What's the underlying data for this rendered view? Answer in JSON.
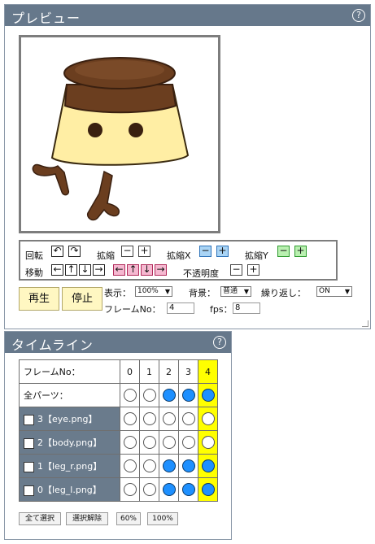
{
  "preview": {
    "title": "プレビュー",
    "help": "?",
    "tools": {
      "rotate_label": "回転",
      "rotate_ccw": "↶",
      "rotate_cw": "↷",
      "scale_label": "拡縮",
      "scale_x_label": "拡縮X",
      "scale_y_label": "拡縮Y",
      "minus": "−",
      "plus": "+",
      "move_label": "移動",
      "opacity_label": "不透明度",
      "arrows": [
        "←",
        "↑",
        "↓",
        "→"
      ]
    },
    "play_label": "再生",
    "stop_label": "停止",
    "display_label": "表示：",
    "display_value": "100%",
    "bg_label": "背景：",
    "bg_value": "普通",
    "repeat_label": "繰り返し：",
    "repeat_value": "ON",
    "frame_no_label": "フレームNo：",
    "frame_no_value": "4",
    "fps_label": "fps：",
    "fps_value": "8",
    "colors": {
      "titlebar": "#66788b",
      "button_bg": "#fff7c2",
      "pudding_top": "#6b3e1f",
      "pudding_body": "#ffeea4"
    }
  },
  "timeline": {
    "title": "タイムライン",
    "help": "?",
    "frame_no_label": "フレームNo：",
    "frames": [
      "0",
      "1",
      "2",
      "3",
      "4"
    ],
    "all_parts_label": "全パーツ：",
    "rows": [
      {
        "label": "3【eye.png】",
        "keys": [
          false,
          false,
          false,
          false,
          false
        ]
      },
      {
        "label": "2【body.png】",
        "keys": [
          false,
          false,
          false,
          false,
          false
        ]
      },
      {
        "label": "1【leg_r.png】",
        "keys": [
          false,
          false,
          true,
          true,
          true
        ]
      },
      {
        "label": "0【leg_l.png】",
        "keys": [
          false,
          false,
          true,
          true,
          true
        ]
      }
    ],
    "all_parts_keys": [
      false,
      false,
      true,
      true,
      true
    ],
    "select_all_label": "全て選択",
    "deselect_label": "選択解除",
    "zoom_60_label": "60%",
    "zoom_100_label": "100%"
  }
}
